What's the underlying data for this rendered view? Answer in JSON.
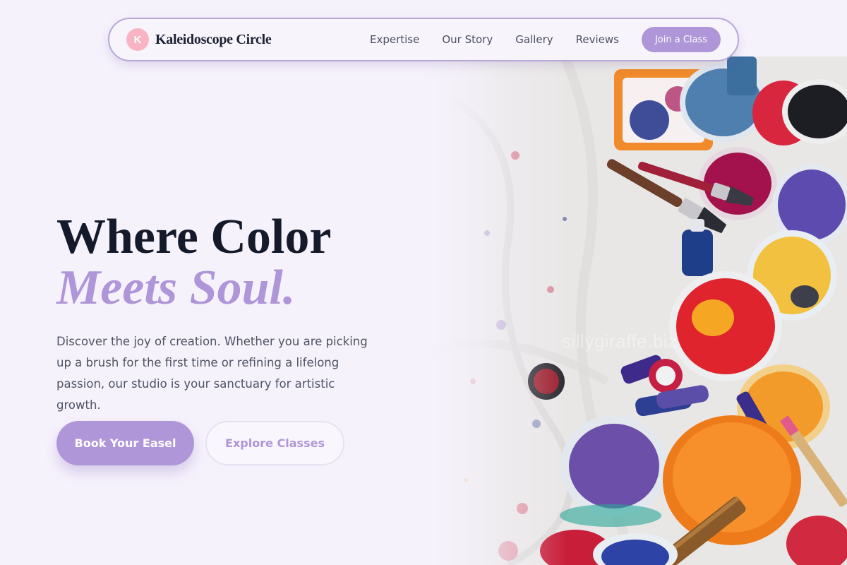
{
  "brand": {
    "mark_letter": "K",
    "name": "Kaleidoscope Circle"
  },
  "nav": {
    "links": [
      "Expertise",
      "Our Story",
      "Gallery",
      "Reviews"
    ],
    "cta_label": "Join a Class"
  },
  "hero": {
    "headline_line1": "Where Color",
    "headline_line2": "Meets Soul.",
    "description": "Discover the joy of creation. Whether you are picking up a brush for the first time or refining a lifelong passion, our studio is your sanctuary for artistic growth.",
    "primary_button": "Book Your Easel",
    "secondary_button": "Explore Classes",
    "image_watermark": "sillygiraffe.biz"
  },
  "colors": {
    "accent": "#ae96d8",
    "brand_mark": "#f8b4c2",
    "headline": "#151a2b",
    "background": "#f6f2fc"
  },
  "icons": {
    "brand": "brand-monogram-icon"
  }
}
